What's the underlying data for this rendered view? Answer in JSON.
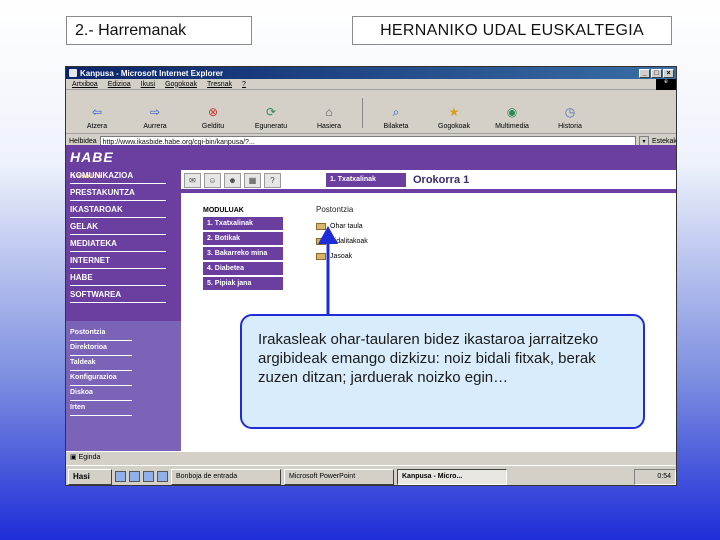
{
  "slide": {
    "title_left": "2.- Harremanak",
    "title_right": "HERNANIKO UDAL EUSKALTEGIA"
  },
  "browser": {
    "window_title": "Kanpusa - Microsoft Internet Explorer",
    "menu": [
      "Artxiboa",
      "Edizioa",
      "Ikusi",
      "Gogokoak",
      "Tresnak",
      "?"
    ],
    "toolbar": [
      "Atzera",
      "Aurrera",
      "Gelditu",
      "Eguneratu",
      "Hasiera",
      "Bilaketa",
      "Gogokoak",
      "Multimedia",
      "Historia"
    ],
    "address_label": "Helbidea",
    "address": "http://www.ikasbide.habe.org/cgi-bin/kanpusa/?...",
    "links_label": "Estekak",
    "status_text": "Eginda"
  },
  "hade": {
    "logo": "HABE",
    "logo_sub": "ikasbide",
    "nav": [
      "KOMUNIKAZIOA",
      "PRESTAKUNTZA",
      "IKASTAROAK",
      "GELAK",
      "MEDIATEKA",
      "INTERNET",
      "HABE",
      "SOFTWAREA"
    ],
    "bottom_nav": [
      "Postontzia",
      "Direktorioa",
      "Taldeak",
      "Konfigurazioa",
      "Diskoa",
      "Irten"
    ]
  },
  "course": {
    "tab": "1. Txatxalinak",
    "heading": "Orokorra 1",
    "module_heading": "MODULUAK",
    "modules": [
      "1. Txatxalinak",
      "2. Botikak",
      "3. Bakarreko mina",
      "4. Diabetea",
      "5. Pipiak jana"
    ],
    "mail_heading": "Postontzia",
    "mail_items": [
      "Ohar taula",
      "Bidalitakoak",
      "Jasoak"
    ]
  },
  "callout": {
    "text": "Irakasleak ohar-taularen bidez ikastaroa jarraitzeko argibideak emango dizkizu: noiz bidali fitxak, berak zuzen ditzan; jarduerak noizko egin…"
  },
  "taskbar": {
    "start": "Hasi",
    "tasks": [
      "Bonboja de entrada",
      "Microsoft PowerPoint",
      "Kanpusa - Micro..."
    ],
    "clock": "0:54"
  }
}
